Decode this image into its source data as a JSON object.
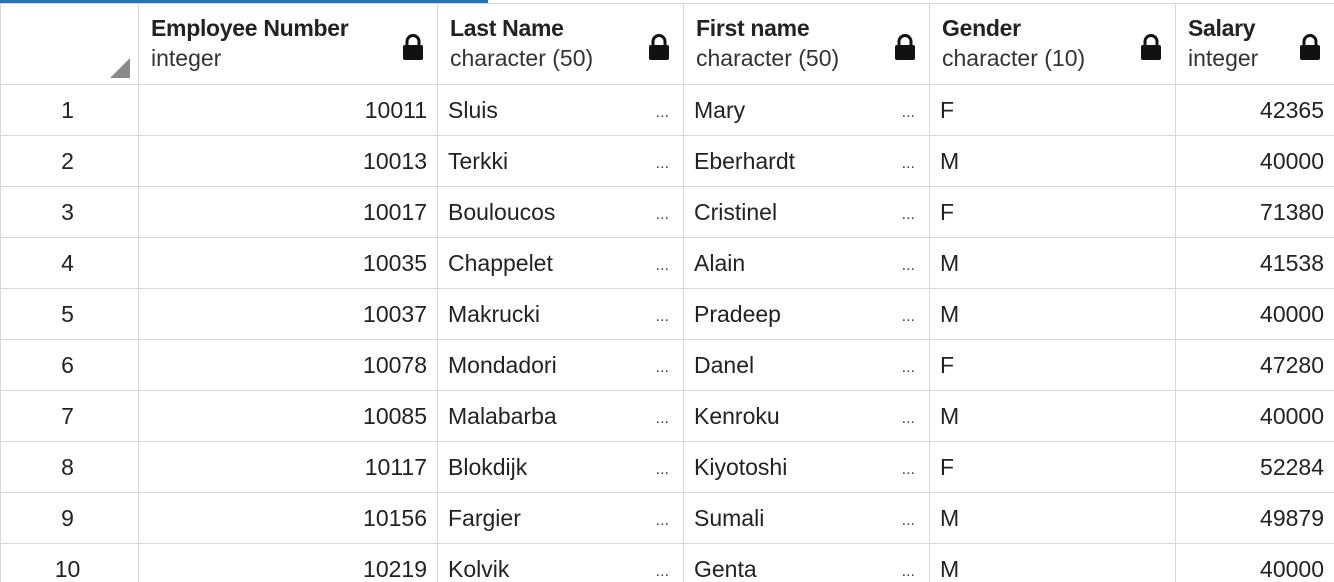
{
  "columns": [
    {
      "name": "Employee Number",
      "type": "integer"
    },
    {
      "name": "Last Name",
      "type": "character (50)"
    },
    {
      "name": "First name",
      "type": "character (50)"
    },
    {
      "name": "Gender",
      "type": "character (10)"
    },
    {
      "name": "Salary",
      "type": "integer"
    }
  ],
  "ellipsis": "...",
  "rows": [
    {
      "n": "1",
      "emp": "10011",
      "last": "Sluis",
      "first": "Mary",
      "gender": "F",
      "salary": "42365"
    },
    {
      "n": "2",
      "emp": "10013",
      "last": "Terkki",
      "first": "Eberhardt",
      "gender": "M",
      "salary": "40000"
    },
    {
      "n": "3",
      "emp": "10017",
      "last": "Bouloucos",
      "first": "Cristinel",
      "gender": "F",
      "salary": "71380"
    },
    {
      "n": "4",
      "emp": "10035",
      "last": "Chappelet",
      "first": "Alain",
      "gender": "M",
      "salary": "41538"
    },
    {
      "n": "5",
      "emp": "10037",
      "last": "Makrucki",
      "first": "Pradeep",
      "gender": "M",
      "salary": "40000"
    },
    {
      "n": "6",
      "emp": "10078",
      "last": "Mondadori",
      "first": "Danel",
      "gender": "F",
      "salary": "47280"
    },
    {
      "n": "7",
      "emp": "10085",
      "last": "Malabarba",
      "first": "Kenroku",
      "gender": "M",
      "salary": "40000"
    },
    {
      "n": "8",
      "emp": "10117",
      "last": "Blokdijk",
      "first": "Kiyotoshi",
      "gender": "F",
      "salary": "52284"
    },
    {
      "n": "9",
      "emp": "10156",
      "last": "Fargier",
      "first": "Sumali",
      "gender": "M",
      "salary": "49879"
    },
    {
      "n": "10",
      "emp": "10219",
      "last": "Kolvik",
      "first": "Genta",
      "gender": "M",
      "salary": "40000"
    }
  ]
}
